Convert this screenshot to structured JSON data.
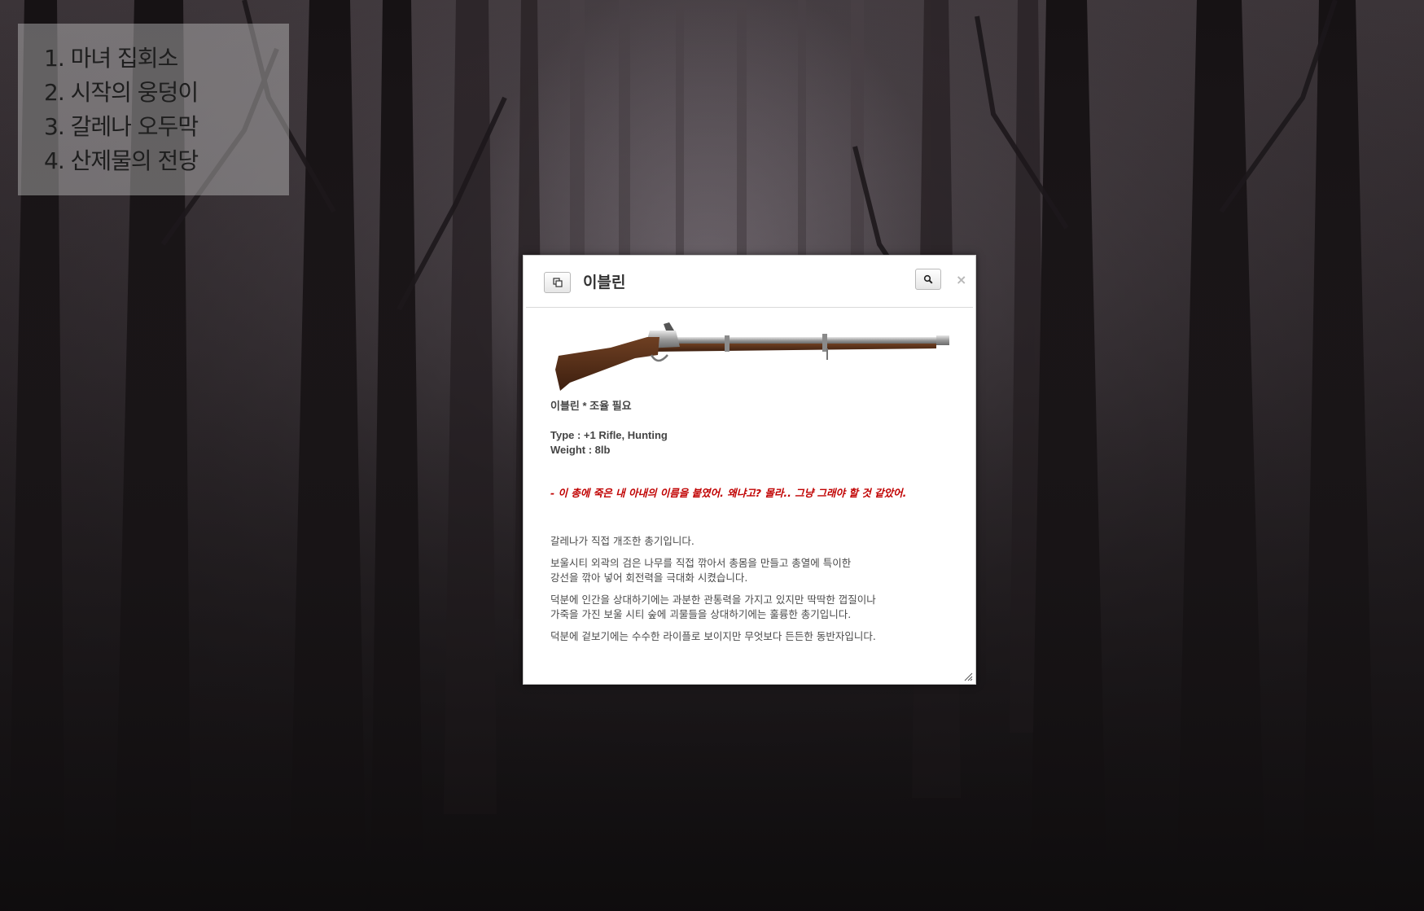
{
  "locations": [
    "1. 마녀 집회소",
    "2. 시작의 웅덩이",
    "3. 갈레나 오두막",
    "4. 산제물의 전당"
  ],
  "dialog": {
    "title": "이블린",
    "item_name": "이블린 * 조율 필요",
    "type_line": "Type : +1  Rifle, Hunting",
    "weight_line": "Weight : 8lb",
    "quote": "- 이 총에 죽은 내 아내의 이름을 붙였어. 왜냐고? 몰라.. 그냥 그래야 할 것 같았어.",
    "description": {
      "p1": "갈레나가 직접 개조한 총기입니다.",
      "p2_line1": "보울시티 외곽의 검은 나무를 직접 깎아서 총몸을 만들고 총열에 특이한",
      "p2_line2": "강선을 깎아 넣어 회전력을 극대화 시켰습니다.",
      "p3_line1": "덕분에 인간을 상대하기에는 과분한 관통력을 가지고 있지만 딱딱한 껍질이나",
      "p3_line2": "가죽을 가진 보울 시티 숲에 괴물들을 상대하기에는 훌륭한 총기입니다.",
      "p4": "덕분에 겉보기에는 수수한 라이플로 보이지만 무엇보다 든든한 동반자입니다."
    },
    "close_glyph": "×"
  },
  "icons": {
    "copy": "copy-icon",
    "search": "search-icon",
    "close": "close-icon",
    "resize": "resize-grip-icon"
  },
  "colors": {
    "quote": "#c00000",
    "body_text": "#4a4a4a",
    "panel_bg": "rgba(205,205,205,0.42)"
  }
}
